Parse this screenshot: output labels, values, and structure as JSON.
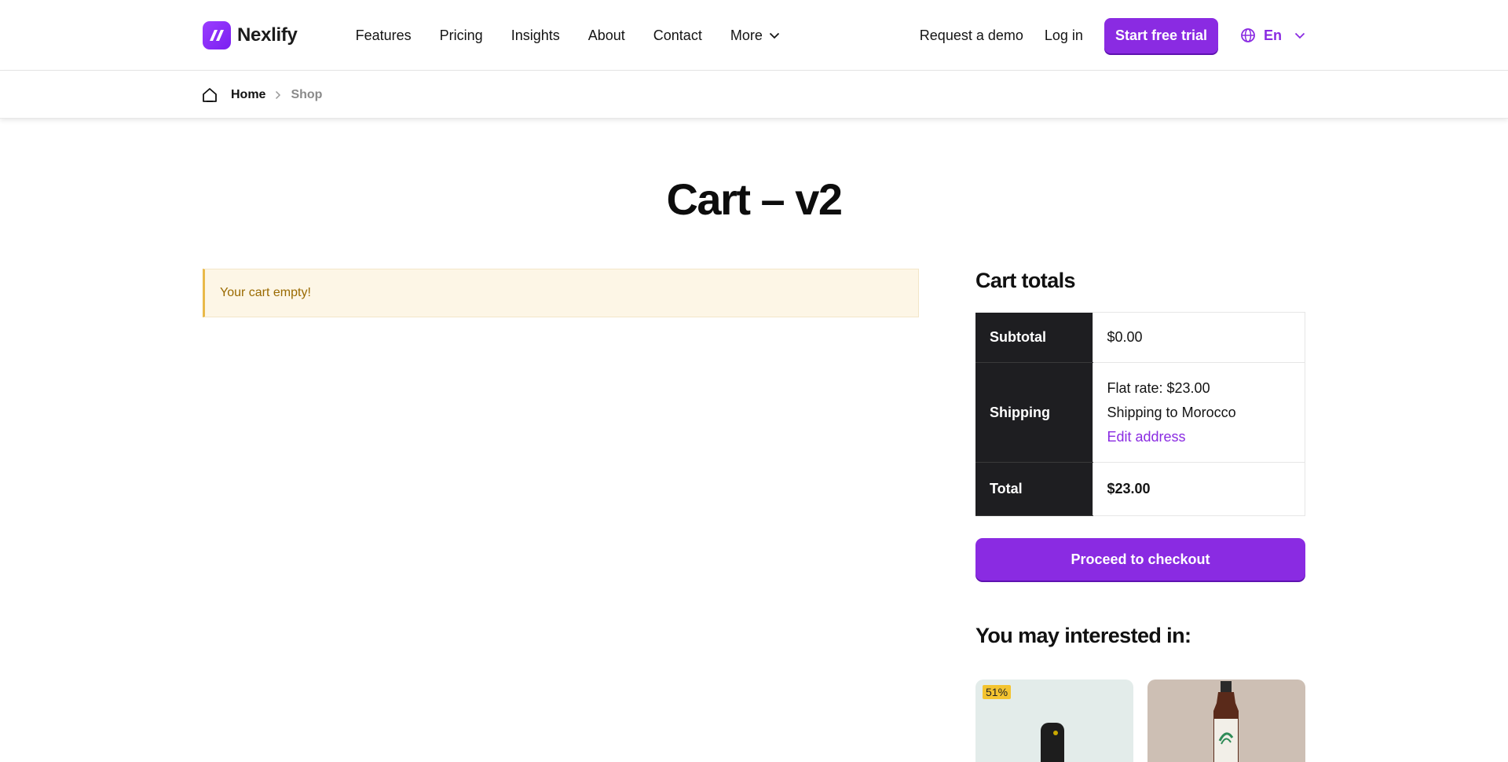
{
  "header": {
    "logo_text": "Nexlify",
    "nav": [
      "Features",
      "Pricing",
      "Insights",
      "About",
      "Contact",
      "More"
    ],
    "request_demo": "Request a demo",
    "login": "Log in",
    "trial_button": "Start free trial",
    "language": "En",
    "accent_color": "#8a2be2"
  },
  "breadcrumb": {
    "home": "Home",
    "current": "Shop"
  },
  "page": {
    "title": "Cart – v2"
  },
  "notice": {
    "text": "Your cart empty!"
  },
  "cart_totals": {
    "title": "Cart totals",
    "subtotal_label": "Subtotal",
    "subtotal_value": "$0.00",
    "shipping_label": "Shipping",
    "shipping_rate": "Flat rate: $23.00",
    "shipping_dest": "Shipping to Morocco",
    "edit_address": "Edit address",
    "total_label": "Total",
    "total_value": "$23.00",
    "checkout_button": "Proceed to checkout"
  },
  "recommendations": {
    "title": "You may interested in:",
    "products": [
      {
        "badge": "51%"
      },
      {
        "badge": ""
      }
    ]
  }
}
